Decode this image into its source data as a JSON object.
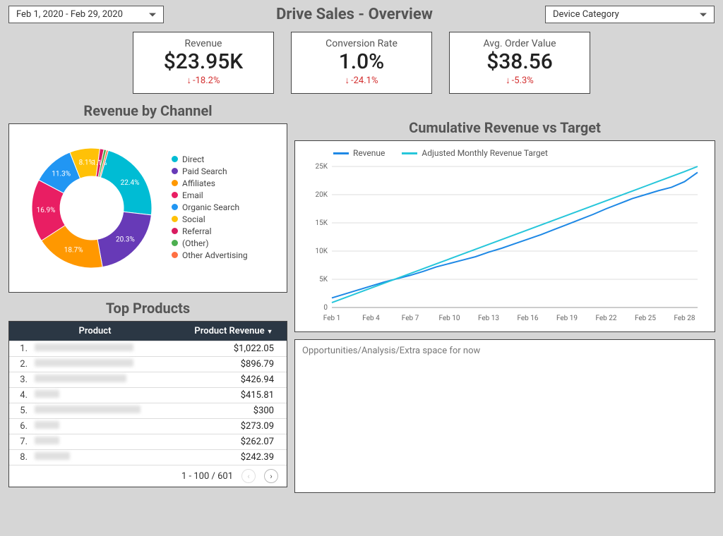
{
  "header": {
    "date_range": "Feb 1, 2020 - Feb 29, 2020",
    "title": "Drive Sales - Overview",
    "device_filter": "Device Category"
  },
  "kpis": [
    {
      "label": "Revenue",
      "value": "$23.95K",
      "delta": "-18.2%"
    },
    {
      "label": "Conversion Rate",
      "value": "1.0%",
      "delta": "-24.1%"
    },
    {
      "label": "Avg. Order Value",
      "value": "$38.56",
      "delta": "-5.3%"
    }
  ],
  "revenue_channel_title": "Revenue by Channel",
  "cumulative_title": "Cumulative Revenue vs Target",
  "top_products_title": "Top Products",
  "table": {
    "headers": {
      "product": "Product",
      "revenue": "Product Revenue"
    },
    "rows": [
      {
        "idx": "1.",
        "rev": "$1,022.05",
        "blur_w": 140
      },
      {
        "idx": "2.",
        "rev": "$896.79",
        "blur_w": 140
      },
      {
        "idx": "3.",
        "rev": "$426.94",
        "blur_w": 130
      },
      {
        "idx": "4.",
        "rev": "$415.81",
        "blur_w": 35
      },
      {
        "idx": "5.",
        "rev": "$300",
        "blur_w": 150
      },
      {
        "idx": "6.",
        "rev": "$273.09",
        "blur_w": 35
      },
      {
        "idx": "7.",
        "rev": "$262.07",
        "blur_w": 35
      },
      {
        "idx": "8.",
        "rev": "$242.39",
        "blur_w": 50
      }
    ],
    "footer": "1 - 100 / 601"
  },
  "extra_text": "Opportunities/Analysis/Extra space for now",
  "line_legend": {
    "a": "Revenue",
    "b": "Adjusted Monthly Revenue Target"
  },
  "chart_data": [
    {
      "type": "pie",
      "title": "Revenue by Channel",
      "series": [
        {
          "name": "Direct",
          "value": 22.4,
          "color": "#00bcd4"
        },
        {
          "name": "Paid Search",
          "value": 20.3,
          "color": "#673ab7"
        },
        {
          "name": "Affiliates",
          "value": 18.7,
          "color": "#ff9800"
        },
        {
          "name": "Email",
          "value": 16.9,
          "color": "#e91e63"
        },
        {
          "name": "Organic Search",
          "value": 11.3,
          "color": "#2196f3"
        },
        {
          "name": "Social",
          "value": 8.1,
          "color": "#ffc107"
        },
        {
          "name": "Referral",
          "value": 1.1,
          "color": "#d81b60"
        },
        {
          "name": "(Other)",
          "value": 0.7,
          "color": "#4caf50"
        },
        {
          "name": "Other Advertising",
          "value": 0.5,
          "color": "#ff7043"
        }
      ]
    },
    {
      "type": "line",
      "title": "Cumulative Revenue vs Target",
      "xlabel": "",
      "ylabel": "",
      "x_tick_labels": [
        "Feb 1",
        "Feb 4",
        "Feb 7",
        "Feb 10",
        "Feb 13",
        "Feb 16",
        "Feb 19",
        "Feb 22",
        "Feb 25",
        "Feb 28"
      ],
      "y_tick_labels": [
        "0",
        "5K",
        "10K",
        "15K",
        "20K",
        "25K"
      ],
      "ylim": [
        0,
        25000
      ],
      "x_days": [
        1,
        2,
        3,
        4,
        5,
        6,
        7,
        8,
        9,
        10,
        11,
        12,
        13,
        14,
        15,
        16,
        17,
        18,
        19,
        20,
        21,
        22,
        23,
        24,
        25,
        26,
        27,
        28,
        29
      ],
      "series": [
        {
          "name": "Revenue",
          "color": "#1e88e5",
          "values": [
            1700,
            2400,
            3100,
            3800,
            4500,
            5100,
            5700,
            6400,
            7200,
            7800,
            8400,
            9000,
            9800,
            10500,
            11300,
            12100,
            12900,
            13800,
            14700,
            15600,
            16500,
            17500,
            18400,
            19300,
            20000,
            20700,
            21300,
            22300,
            23950
          ]
        },
        {
          "name": "Adjusted Monthly Revenue Target",
          "color": "#26c6da",
          "values": [
            860,
            1720,
            2580,
            3440,
            4300,
            5160,
            6020,
            6880,
            7740,
            8600,
            9460,
            10320,
            11180,
            12040,
            12900,
            13760,
            14620,
            15480,
            16340,
            17200,
            18060,
            18920,
            19780,
            20640,
            21500,
            22360,
            23220,
            24080,
            25000
          ]
        }
      ]
    }
  ]
}
